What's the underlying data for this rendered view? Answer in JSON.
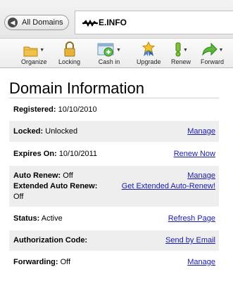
{
  "header": {
    "back_label": "All Domains",
    "domain": "E.INFO"
  },
  "toolbar": {
    "organize": "Organize",
    "locking": "Locking",
    "cashin": "Cash in",
    "upgrade": "Upgrade",
    "renew": "Renew",
    "forward": "Forward"
  },
  "page_title": "Domain Information",
  "rows": {
    "registered": {
      "label": "Registered:",
      "value": "10/10/2010"
    },
    "locked": {
      "label": "Locked:",
      "value": "Unlocked",
      "link": "Manage"
    },
    "expires": {
      "label": "Expires On:",
      "value": "10/10/2011",
      "link": "Renew Now"
    },
    "auto_renew": {
      "label": "Auto Renew:",
      "value": "Off",
      "link": "Manage"
    },
    "ext_auto_renew": {
      "label": "Extended Auto Renew:",
      "value": "Off",
      "link": "Get Extended Auto-Renew!"
    },
    "status": {
      "label": "Status:",
      "value": "Active",
      "link": "Refresh Page"
    },
    "auth_code": {
      "label": "Authorization Code:",
      "link": "Send by Email"
    },
    "forwarding": {
      "label": "Forwarding:",
      "value": "Off",
      "link": "Manage"
    }
  }
}
